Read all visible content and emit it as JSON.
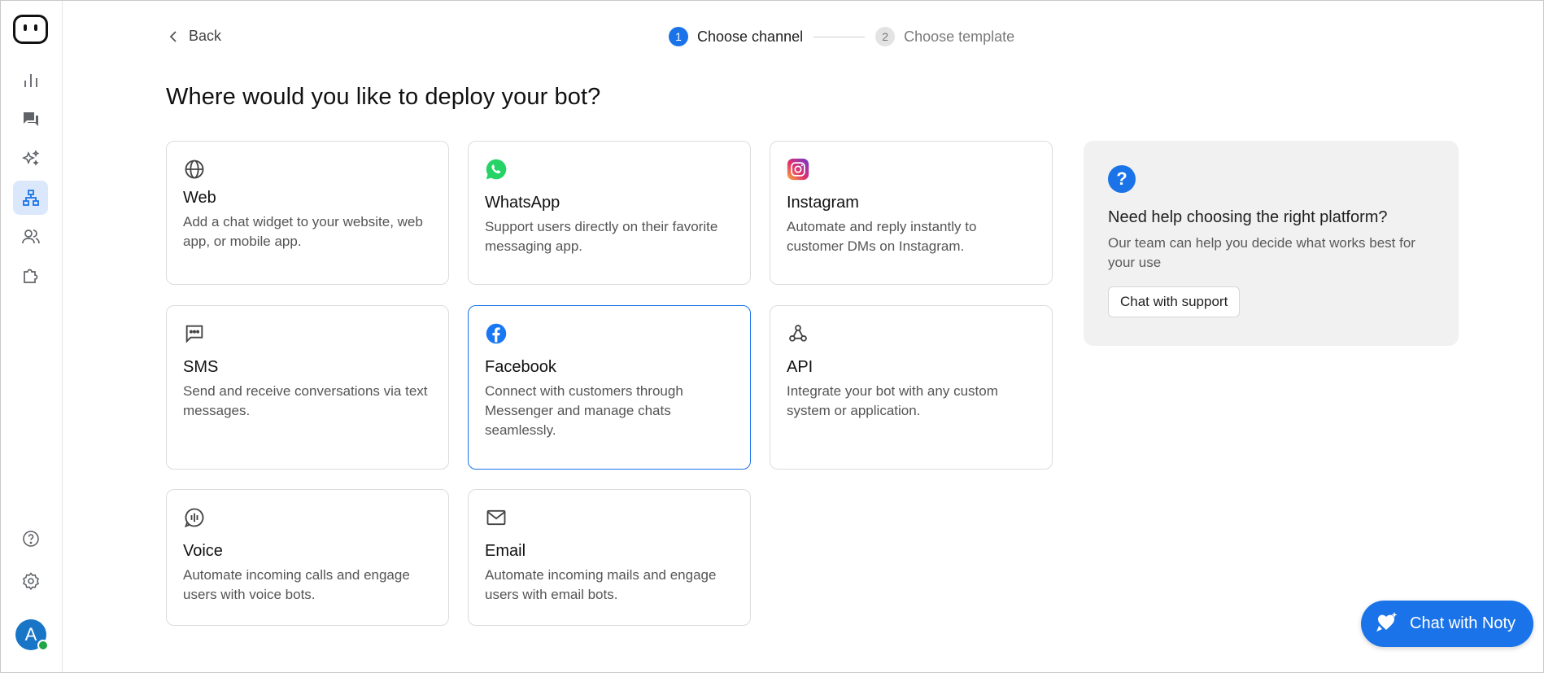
{
  "nav": {
    "back_label": "Back",
    "steps": [
      {
        "num": "1",
        "label": "Choose channel"
      },
      {
        "num": "2",
        "label": "Choose template"
      }
    ]
  },
  "page": {
    "title": "Where would you like to deploy your bot?"
  },
  "channels": [
    {
      "icon": "globe-icon",
      "title": "Web",
      "desc": "Add a chat widget to your website, web app, or mobile app."
    },
    {
      "icon": "whatsapp-icon",
      "title": "WhatsApp",
      "desc": "Support users directly on their favorite messaging app."
    },
    {
      "icon": "instagram-icon",
      "title": "Instagram",
      "desc": "Automate and reply instantly to customer DMs on Instagram."
    },
    {
      "icon": "sms-icon",
      "title": "SMS",
      "desc": "Send and receive conversations via text messages."
    },
    {
      "icon": "facebook-icon",
      "title": "Facebook",
      "desc": "Connect with customers through Messenger and manage chats seamlessly."
    },
    {
      "icon": "webhook-icon",
      "title": "API",
      "desc": "Integrate your bot with any custom system or application."
    },
    {
      "icon": "voice-icon",
      "title": "Voice",
      "desc": "Automate incoming calls and engage users with voice bots."
    },
    {
      "icon": "email-icon",
      "title": "Email",
      "desc": "Automate incoming mails and engage users with email bots."
    }
  ],
  "help": {
    "icon": "?",
    "title": "Need help choosing the right platform?",
    "desc": "Our team can help you decide what works best for your use",
    "button_label": "Chat with support"
  },
  "chat_fab": {
    "label": "Chat with Noty"
  },
  "user": {
    "avatar_initial": "A",
    "status": "online"
  },
  "colors": {
    "accent": "#1a73e8",
    "whatsapp": "#25d366",
    "facebook": "#1877f2",
    "online": "#22a447"
  }
}
